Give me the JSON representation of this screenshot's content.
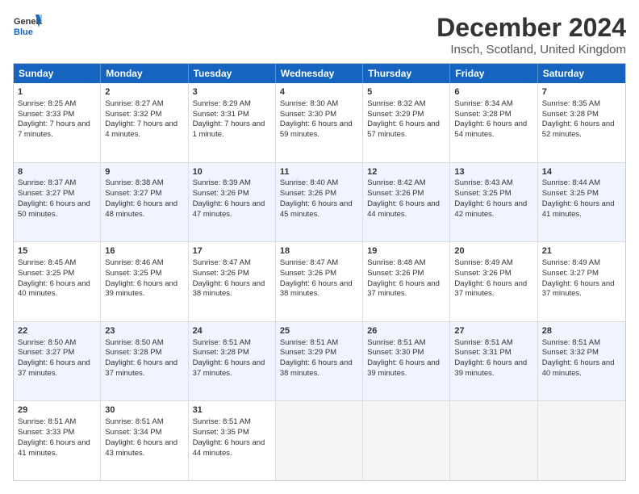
{
  "header": {
    "logo_line1": "General",
    "logo_line2": "Blue",
    "title": "December 2024",
    "subtitle": "Insch, Scotland, United Kingdom"
  },
  "days": [
    "Sunday",
    "Monday",
    "Tuesday",
    "Wednesday",
    "Thursday",
    "Friday",
    "Saturday"
  ],
  "weeks": [
    [
      {
        "day": "1",
        "sunrise": "8:25 AM",
        "sunset": "3:33 PM",
        "daylight": "7 hours and 7 minutes."
      },
      {
        "day": "2",
        "sunrise": "8:27 AM",
        "sunset": "3:32 PM",
        "daylight": "7 hours and 4 minutes."
      },
      {
        "day": "3",
        "sunrise": "8:29 AM",
        "sunset": "3:31 PM",
        "daylight": "7 hours and 1 minute."
      },
      {
        "day": "4",
        "sunrise": "8:30 AM",
        "sunset": "3:30 PM",
        "daylight": "6 hours and 59 minutes."
      },
      {
        "day": "5",
        "sunrise": "8:32 AM",
        "sunset": "3:29 PM",
        "daylight": "6 hours and 57 minutes."
      },
      {
        "day": "6",
        "sunrise": "8:34 AM",
        "sunset": "3:28 PM",
        "daylight": "6 hours and 54 minutes."
      },
      {
        "day": "7",
        "sunrise": "8:35 AM",
        "sunset": "3:28 PM",
        "daylight": "6 hours and 52 minutes."
      }
    ],
    [
      {
        "day": "8",
        "sunrise": "8:37 AM",
        "sunset": "3:27 PM",
        "daylight": "6 hours and 50 minutes."
      },
      {
        "day": "9",
        "sunrise": "8:38 AM",
        "sunset": "3:27 PM",
        "daylight": "6 hours and 48 minutes."
      },
      {
        "day": "10",
        "sunrise": "8:39 AM",
        "sunset": "3:26 PM",
        "daylight": "6 hours and 47 minutes."
      },
      {
        "day": "11",
        "sunrise": "8:40 AM",
        "sunset": "3:26 PM",
        "daylight": "6 hours and 45 minutes."
      },
      {
        "day": "12",
        "sunrise": "8:42 AM",
        "sunset": "3:26 PM",
        "daylight": "6 hours and 44 minutes."
      },
      {
        "day": "13",
        "sunrise": "8:43 AM",
        "sunset": "3:25 PM",
        "daylight": "6 hours and 42 minutes."
      },
      {
        "day": "14",
        "sunrise": "8:44 AM",
        "sunset": "3:25 PM",
        "daylight": "6 hours and 41 minutes."
      }
    ],
    [
      {
        "day": "15",
        "sunrise": "8:45 AM",
        "sunset": "3:25 PM",
        "daylight": "6 hours and 40 minutes."
      },
      {
        "day": "16",
        "sunrise": "8:46 AM",
        "sunset": "3:25 PM",
        "daylight": "6 hours and 39 minutes."
      },
      {
        "day": "17",
        "sunrise": "8:47 AM",
        "sunset": "3:26 PM",
        "daylight": "6 hours and 38 minutes."
      },
      {
        "day": "18",
        "sunrise": "8:47 AM",
        "sunset": "3:26 PM",
        "daylight": "6 hours and 38 minutes."
      },
      {
        "day": "19",
        "sunrise": "8:48 AM",
        "sunset": "3:26 PM",
        "daylight": "6 hours and 37 minutes."
      },
      {
        "day": "20",
        "sunrise": "8:49 AM",
        "sunset": "3:26 PM",
        "daylight": "6 hours and 37 minutes."
      },
      {
        "day": "21",
        "sunrise": "8:49 AM",
        "sunset": "3:27 PM",
        "daylight": "6 hours and 37 minutes."
      }
    ],
    [
      {
        "day": "22",
        "sunrise": "8:50 AM",
        "sunset": "3:27 PM",
        "daylight": "6 hours and 37 minutes."
      },
      {
        "day": "23",
        "sunrise": "8:50 AM",
        "sunset": "3:28 PM",
        "daylight": "6 hours and 37 minutes."
      },
      {
        "day": "24",
        "sunrise": "8:51 AM",
        "sunset": "3:28 PM",
        "daylight": "6 hours and 37 minutes."
      },
      {
        "day": "25",
        "sunrise": "8:51 AM",
        "sunset": "3:29 PM",
        "daylight": "6 hours and 38 minutes."
      },
      {
        "day": "26",
        "sunrise": "8:51 AM",
        "sunset": "3:30 PM",
        "daylight": "6 hours and 39 minutes."
      },
      {
        "day": "27",
        "sunrise": "8:51 AM",
        "sunset": "3:31 PM",
        "daylight": "6 hours and 39 minutes."
      },
      {
        "day": "28",
        "sunrise": "8:51 AM",
        "sunset": "3:32 PM",
        "daylight": "6 hours and 40 minutes."
      }
    ],
    [
      {
        "day": "29",
        "sunrise": "8:51 AM",
        "sunset": "3:33 PM",
        "daylight": "6 hours and 41 minutes."
      },
      {
        "day": "30",
        "sunrise": "8:51 AM",
        "sunset": "3:34 PM",
        "daylight": "6 hours and 43 minutes."
      },
      {
        "day": "31",
        "sunrise": "8:51 AM",
        "sunset": "3:35 PM",
        "daylight": "6 hours and 44 minutes."
      },
      null,
      null,
      null,
      null
    ]
  ]
}
